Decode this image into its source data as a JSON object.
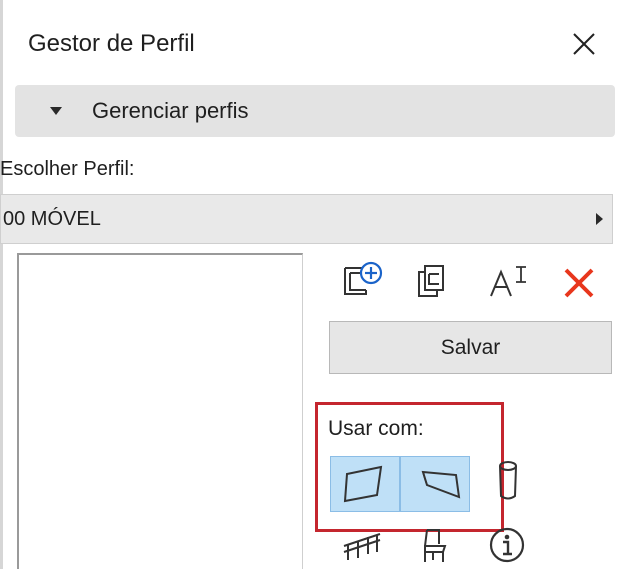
{
  "panel": {
    "title": "Gestor de Perfil",
    "close_icon": "close-icon"
  },
  "section": {
    "label": "Gerenciar perfis",
    "expanded": true,
    "icon": "triangle-down-icon"
  },
  "profile_chooser": {
    "label": "Escolher Perfil:",
    "selected_value": "00 MÓVEL",
    "arrow_icon": "triangle-right-icon"
  },
  "toolbar": {
    "new_profile_icon": "new-profile-icon",
    "duplicate_icon": "duplicate-profile-icon",
    "rename_icon": "rename-icon",
    "rename_glyph": "AI",
    "delete_icon": "delete-icon",
    "delete_color": "#e8361c",
    "save_label": "Salvar"
  },
  "use_with": {
    "label": "Usar com:",
    "highlight_color": "#c4262e",
    "selected_color": "#bfe0f7",
    "buttons": [
      {
        "icon": "wall-tool-icon",
        "selected": true
      },
      {
        "icon": "beam-tool-icon",
        "selected": true
      }
    ],
    "other_icons": [
      "column-tool-icon",
      "railing-tool-icon",
      "object-tool-icon",
      "info-icon"
    ]
  }
}
